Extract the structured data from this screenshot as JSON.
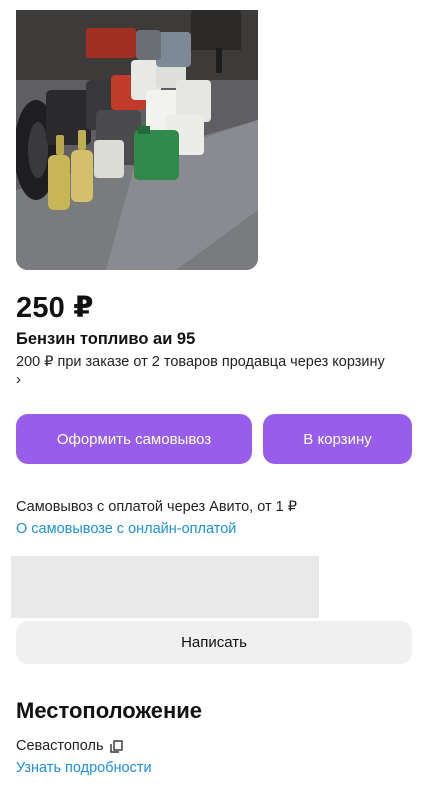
{
  "listing": {
    "photo_icon": "product-photo",
    "price": "250 ₽",
    "title": "Бензин топливо аи 95",
    "promo": "200 ₽ при заказе от 2 товаров продавца через корзину",
    "promo_arrow": "›"
  },
  "actions": {
    "pickup_label": "Оформить самовывоз",
    "cart_label": "В корзину",
    "message_label": "Написать",
    "accent_color": "#965eeb"
  },
  "delivery": {
    "info": "Самовывоз с оплатой через Авито, от 1 ₽",
    "link": "О самовывозе с онлайн-оплатой"
  },
  "location": {
    "heading": "Местоположение",
    "city": "Севастополь",
    "copy_icon": "copy-icon",
    "details_link": "Узнать подробности"
  }
}
